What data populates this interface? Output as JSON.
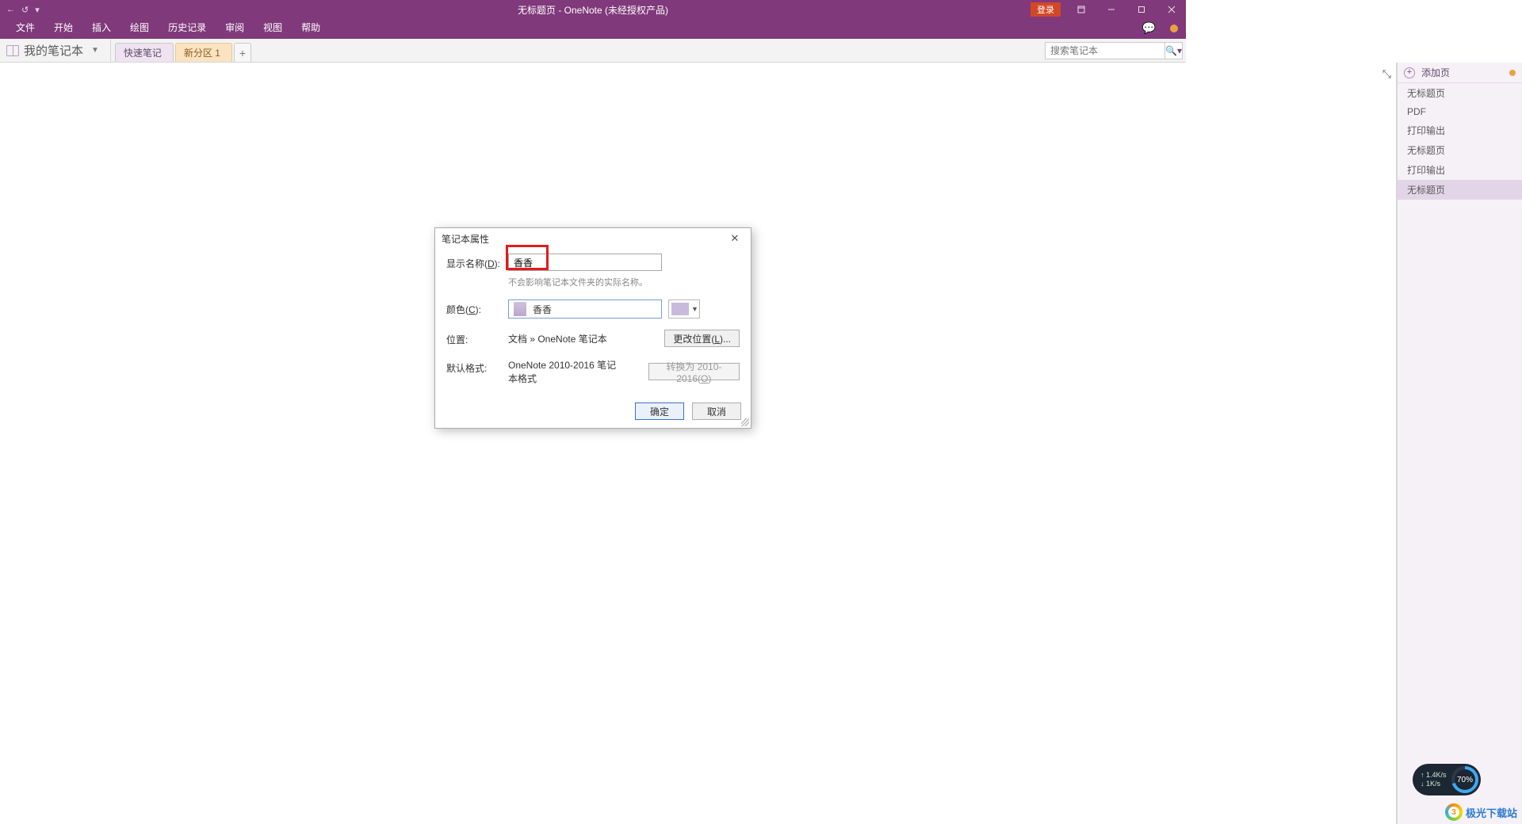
{
  "window": {
    "title": "无标题页  -  OneNote (未经授权产品)",
    "login": "登录"
  },
  "ribbon": {
    "tabs": [
      "文件",
      "开始",
      "插入",
      "绘图",
      "历史记录",
      "审阅",
      "视图",
      "帮助"
    ]
  },
  "notebook": {
    "name": "我的笔记本",
    "sections": [
      {
        "label": "快速笔记",
        "style": "active"
      },
      {
        "label": "新分区 1",
        "style": "orange"
      }
    ],
    "add": "+"
  },
  "search": {
    "placeholder": "搜索笔记本"
  },
  "pages": {
    "add": "添加页",
    "items": [
      "无标题页",
      "PDF",
      "打印输出",
      "无标题页",
      "打印输出",
      "无标题页"
    ],
    "selected_index": 5
  },
  "dialog": {
    "title": "笔记本属性",
    "labels": {
      "display_name": "显示名称(D):",
      "color": "颜色(C):",
      "location": "位置:",
      "format": "默认格式:"
    },
    "display_name_value": "香香",
    "display_name_hint": "不会影响笔记本文件夹的实际名称。",
    "color_value": "香香",
    "location_value": "文档 » OneNote 笔记本",
    "change_location_btn": "更改位置(L)...",
    "format_value": "OneNote 2010-2016 笔记本格式",
    "convert_btn": "转换为 2010-2016(O)",
    "ok": "确定",
    "cancel": "取消"
  },
  "widgets": {
    "net_up": "1.4K/s",
    "net_down": "1K/s",
    "net_pct": "70%",
    "site": "极光下载站"
  }
}
